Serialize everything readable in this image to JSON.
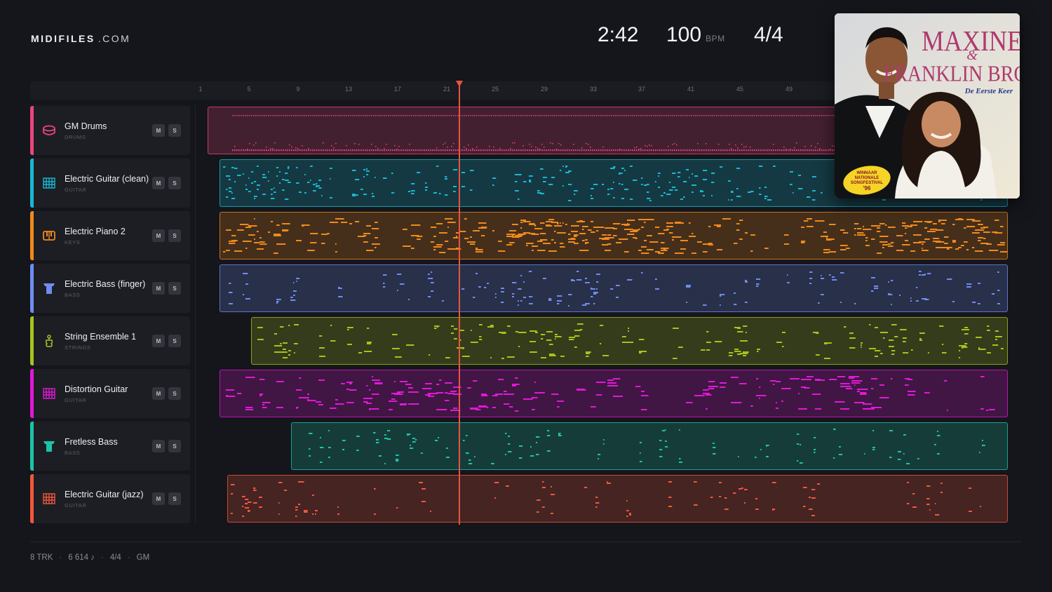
{
  "brand": {
    "name": "MIDIFILES",
    "suffix": ".COM"
  },
  "transport": {
    "time": "2:42",
    "bpm": "100",
    "bpm_unit": "BPM",
    "time_signature": "4/4"
  },
  "ruler": {
    "labels": [
      "1",
      "5",
      "9",
      "13",
      "17",
      "21",
      "25",
      "29",
      "33",
      "37",
      "41",
      "45",
      "49"
    ]
  },
  "playhead": {
    "position_bar": 22
  },
  "cover": {
    "artist_line1": "MAXINE",
    "artist_amp": "&",
    "artist_line2": "FRANKLIN BROWN",
    "album": "De Eerste Keer",
    "badge": [
      "WINNAAR",
      "NATIONALE",
      "SONGFESTIVAL",
      "'96"
    ]
  },
  "tracks": [
    {
      "name": "GM Drums",
      "category": "DRUMS",
      "color": "#e8467c",
      "icon": "drum-icon",
      "mute": "M",
      "solo": "S"
    },
    {
      "name": "Electric Guitar (clean)",
      "category": "GUITAR",
      "color": "#19b7d3",
      "icon": "guitar-grid-icon",
      "mute": "M",
      "solo": "S"
    },
    {
      "name": "Electric Piano 2",
      "category": "KEYS",
      "color": "#f08a1c",
      "icon": "piano-icon",
      "mute": "M",
      "solo": "S"
    },
    {
      "name": "Electric Bass (finger)",
      "category": "BASS",
      "color": "#6f8cf0",
      "icon": "bass-icon",
      "mute": "M",
      "solo": "S"
    },
    {
      "name": "String Ensemble 1",
      "category": "STRINGS",
      "color": "#a8c21c",
      "icon": "violin-icon",
      "mute": "M",
      "solo": "S"
    },
    {
      "name": "Distortion Guitar",
      "category": "GUITAR",
      "color": "#e018d8",
      "icon": "guitar-grid-icon",
      "mute": "M",
      "solo": "S"
    },
    {
      "name": "Fretless Bass",
      "category": "BASS",
      "color": "#1cc4a8",
      "icon": "bass-icon",
      "mute": "M",
      "solo": "S"
    },
    {
      "name": "Electric Guitar (jazz)",
      "category": "GUITAR",
      "color": "#f0583c",
      "icon": "guitar-grid-icon",
      "mute": "M",
      "solo": "S"
    }
  ],
  "footer": {
    "tracks": "8 TRK",
    "notes": "6 614 ♪",
    "time_signature": "4/4",
    "standard": "GM"
  }
}
